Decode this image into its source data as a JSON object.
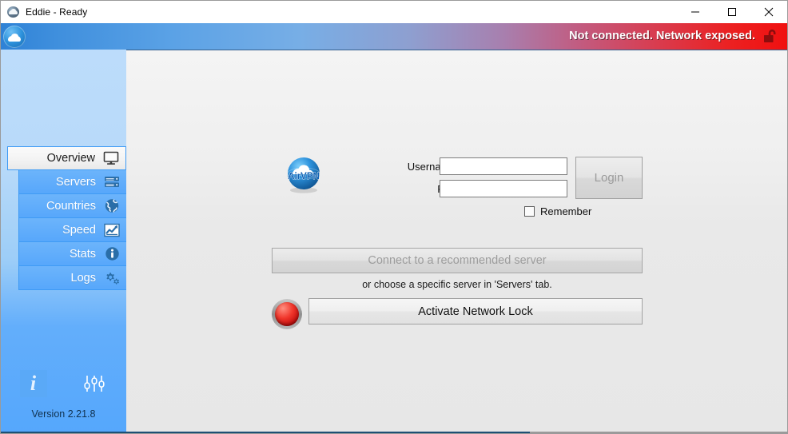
{
  "window": {
    "title": "Eddie - Ready",
    "title_icon": "cloud-icon",
    "controls": {
      "minimize": "minimize-button",
      "maximize": "maximize-button",
      "close": "close-button"
    }
  },
  "statusbar": {
    "logo_icon": "eddie-cloud-logo",
    "message": "Not connected. Network exposed.",
    "lock_icon": "unlocked-padlock-icon",
    "gradient_start": "#2e82d6",
    "gradient_end": "#f01010"
  },
  "sidebar": {
    "items": [
      {
        "label": "Overview",
        "icon": "monitor-icon",
        "selected": true
      },
      {
        "label": "Servers",
        "icon": "server-rack-icon",
        "selected": false
      },
      {
        "label": "Countries",
        "icon": "globe-icon",
        "selected": false
      },
      {
        "label": "Speed",
        "icon": "line-chart-icon",
        "selected": false
      },
      {
        "label": "Stats",
        "icon": "info-circle-icon",
        "selected": false
      },
      {
        "label": "Logs",
        "icon": "gears-icon",
        "selected": false
      }
    ],
    "bottom": {
      "about_icon": "info-italic-icon",
      "preferences_icon": "sliders-icon",
      "version": "Version 2.21.8"
    },
    "accent": "#55a7fc"
  },
  "main": {
    "brand_logo": "airvpn-logo",
    "brand_text": "AirVPN",
    "login": {
      "username_label": "Username/email:",
      "username_value": "",
      "username_placeholder": "",
      "password_label": "Password:",
      "password_value": "",
      "password_placeholder": "",
      "login_button": "Login",
      "remember_label": "Remember",
      "remember_checked": false
    },
    "connect_button": "Connect to a recommended server",
    "hint": "or choose a specific server in 'Servers' tab.",
    "network_lock": {
      "led_icon": "red-led-indicator",
      "button_label": "Activate Network Lock"
    }
  }
}
